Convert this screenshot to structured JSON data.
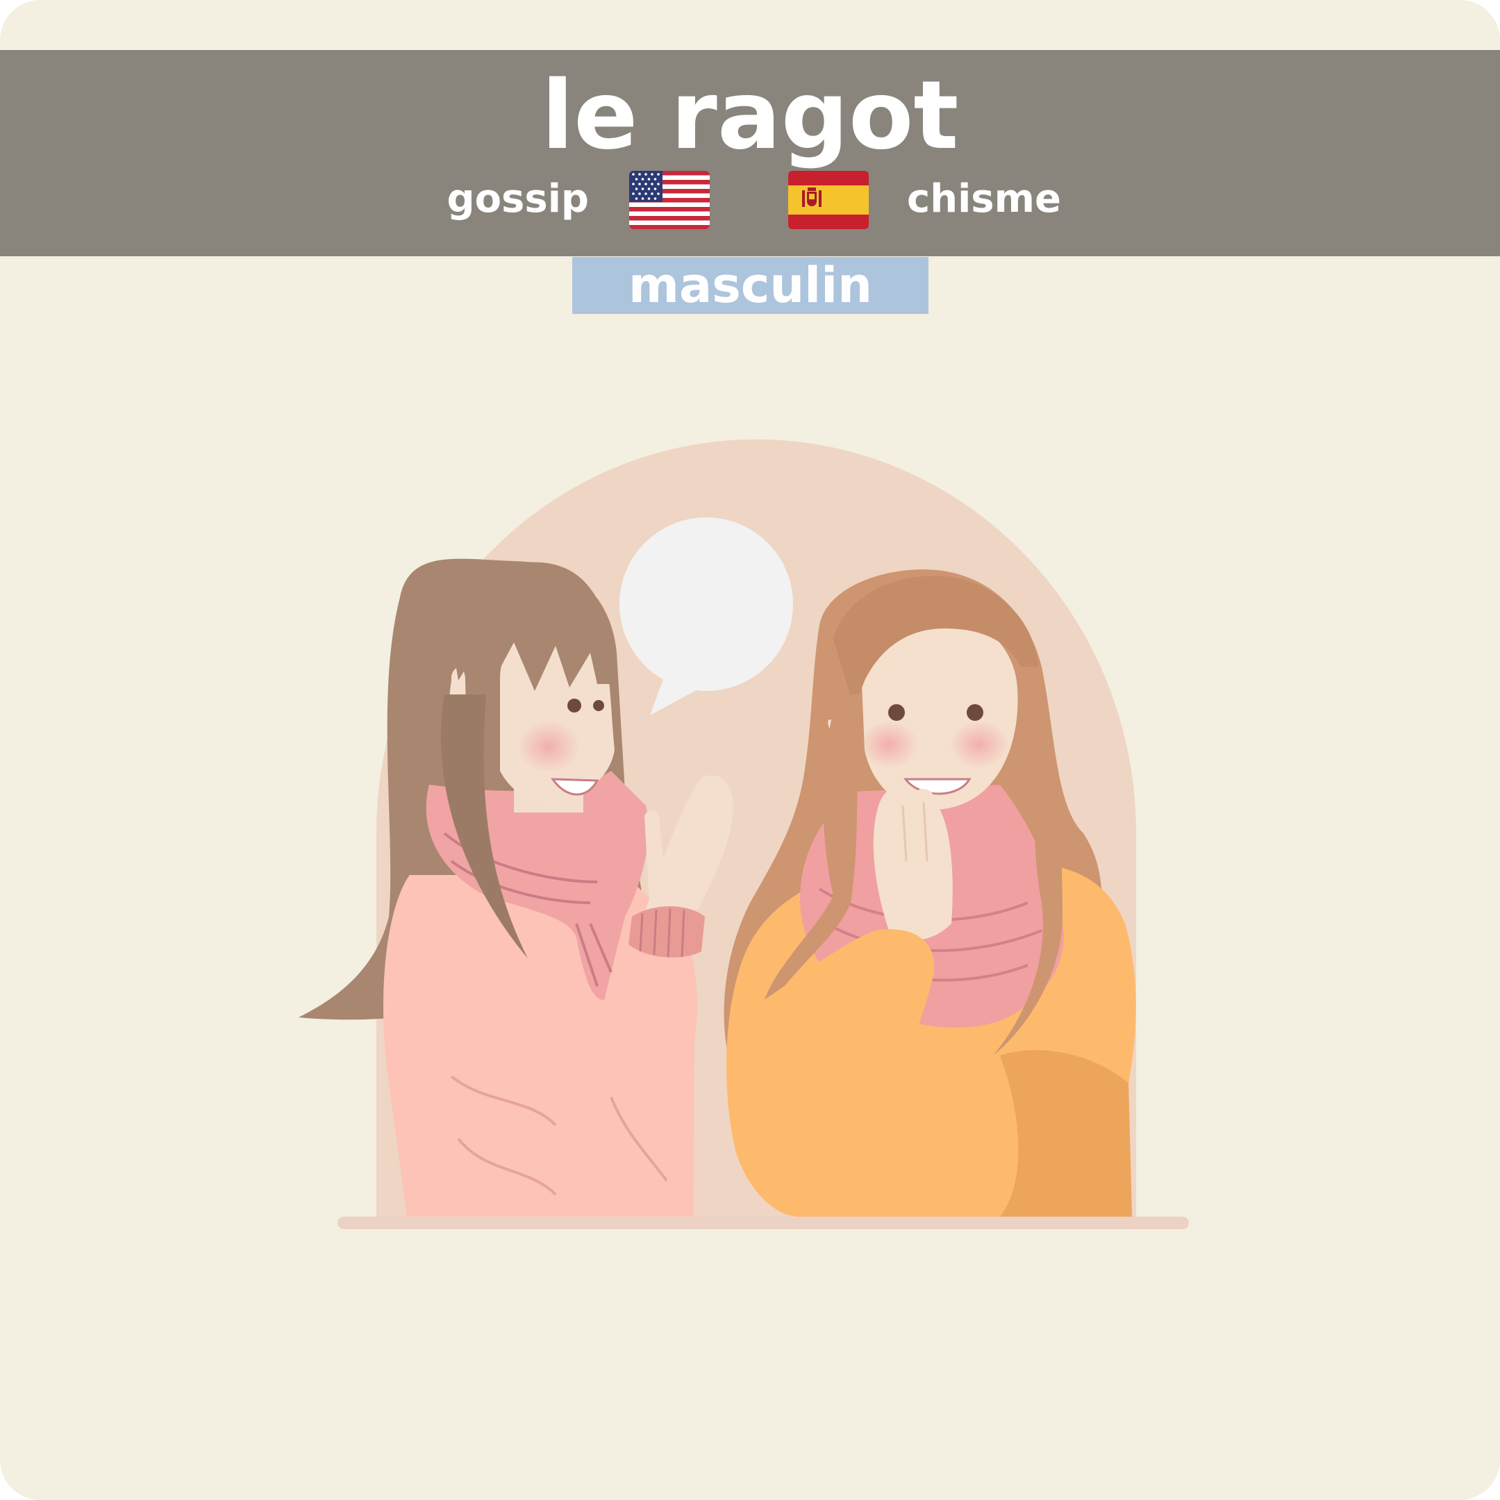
{
  "card": {
    "word": "le ragot",
    "translations": {
      "english": "gossip",
      "spanish": "chisme"
    },
    "gender": "masculin"
  },
  "colors": {
    "background": "#f3efe1",
    "header": "#89857d",
    "gender_badge": "#adc4dd",
    "text": "#ffffff"
  },
  "icons": {
    "english_flag": "us-flag-icon",
    "spanish_flag": "spain-flag-icon"
  }
}
